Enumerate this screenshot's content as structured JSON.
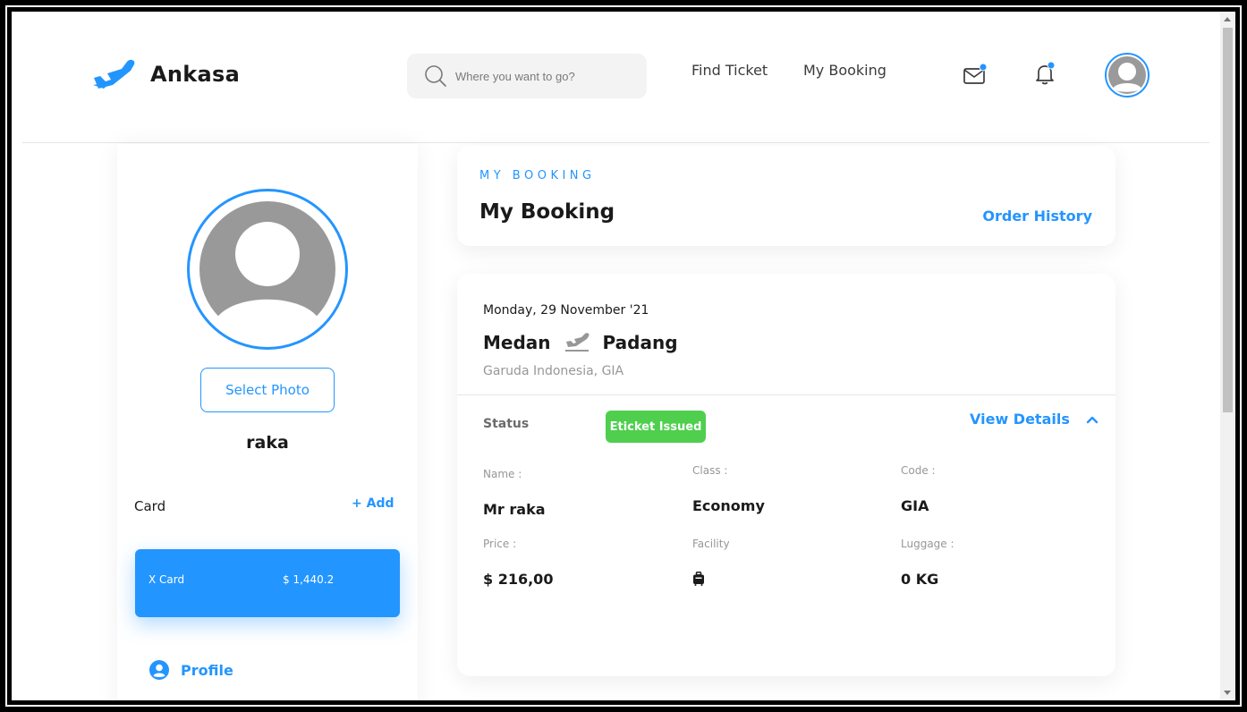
{
  "brand": {
    "name": "Ankasa",
    "accent": "#2395ff",
    "success": "#4fcf4d"
  },
  "search": {
    "placeholder": "Where you want to go?"
  },
  "nav": {
    "find_ticket": "Find Ticket",
    "my_booking": "My Booking"
  },
  "header_icons": [
    "mail-icon",
    "bell-icon",
    "avatar"
  ],
  "sidebar": {
    "select_photo": "Select Photo",
    "username": "raka",
    "card_label": "Card",
    "add_label": "+ Add",
    "card": {
      "name": "X Card",
      "balance": "$ 1,440.2"
    },
    "menu": {
      "profile": "Profile"
    }
  },
  "booking_header": {
    "eyebrow": "MY BOOKING",
    "title": "My Booking",
    "order_history": "Order History"
  },
  "ticket": {
    "date": "Monday, 29 November '21",
    "origin": "Medan",
    "destination": "Padang",
    "airline": "Garuda Indonesia, GIA",
    "status_label": "Status",
    "status_value": "Eticket Issued",
    "view_details": "View Details",
    "fields": {
      "name_label": "Name :",
      "name_value": "Mr raka",
      "class_label": "Class :",
      "class_value": "Economy",
      "code_label": "Code :",
      "code_value": "GIA",
      "price_label": "Price :",
      "price_value": "$ 216,00",
      "facility_label": "Facility",
      "facility_icon": "luggage-icon",
      "luggage_label": "Luggage :",
      "luggage_value": "0 KG"
    }
  }
}
